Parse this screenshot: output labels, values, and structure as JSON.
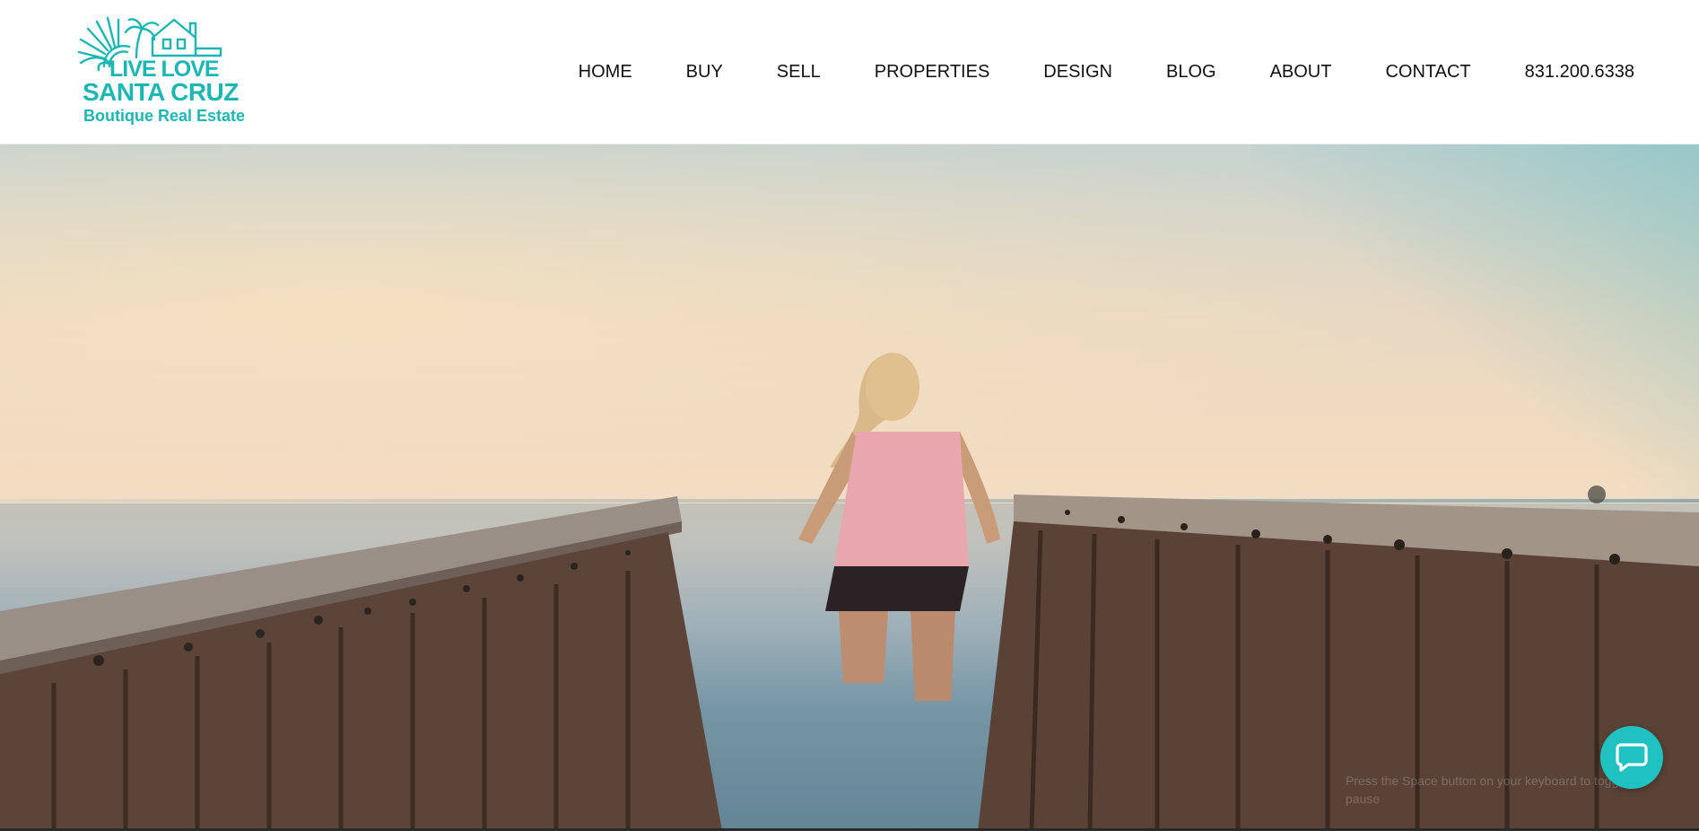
{
  "brand": {
    "line1": "LIVE LOVE",
    "line2": "SANTA CRUZ",
    "tagline": "Boutique Real Estate",
    "color": "#1cb7b3"
  },
  "nav": {
    "items": [
      "HOME",
      "BUY",
      "SELL",
      "PROPERTIES",
      "DESIGN",
      "BLOG",
      "ABOUT",
      "CONTACT"
    ],
    "phone": "831.200.6338"
  },
  "hero": {
    "caption": "Press the Space button on your keyboard to toggle pause"
  },
  "chat": {
    "icon": "chat-bubble-icon",
    "color": "#1fc2c0"
  }
}
